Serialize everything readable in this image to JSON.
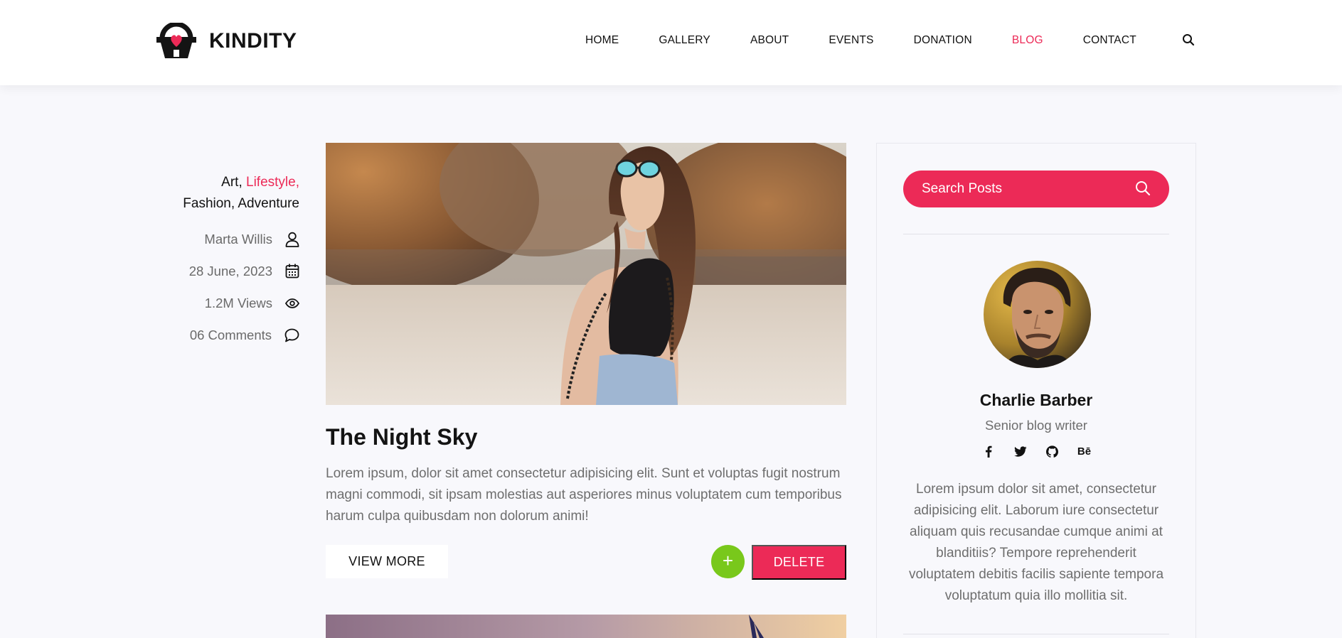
{
  "brand": {
    "name": "KINDITY",
    "accent": "#ec2a57"
  },
  "nav": {
    "items": [
      "HOME",
      "GALLERY",
      "ABOUT",
      "EVENTS",
      "DONATION",
      "BLOG",
      "CONTACT"
    ],
    "active": "BLOG"
  },
  "post": {
    "categories": {
      "first": "Art,",
      "highlight": "Lifestyle,",
      "rest": "Fashion, Adventure"
    },
    "author": "Marta Willis",
    "date": "28 June, 2023",
    "views": "1.2M Views",
    "comments": "06 Comments",
    "title": "The Night Sky",
    "excerpt": "Lorem ipsum, dolor sit amet consectetur adipisicing elit. Sunt et voluptas fugit nostrum magni commodi, sit ipsam molestias aut asperiores minus voluptatem cum temporibus harum culpa quibusdam non dolorum animi!",
    "view_more_label": "VIEW MORE",
    "add_label": "+",
    "delete_label": "DELETE",
    "delete_color": "#ec2a57",
    "add_color": "#79c81b"
  },
  "sidebar": {
    "search_placeholder": "Search Posts",
    "author_name": "Charlie Barber",
    "author_role": "Senior blog writer",
    "socials": [
      "facebook-icon",
      "twitter-icon",
      "github-icon",
      "behance-icon"
    ],
    "behance_label": "Bē",
    "bio": "Lorem ipsum dolor sit amet, consectetur adipisicing elit. Laborum iure consectetur aliquam quis recusandae cumque animi at blanditiis? Tempore reprehenderit voluptatem debitis facilis sapiente tempora voluptatum quia illo mollitia sit."
  }
}
